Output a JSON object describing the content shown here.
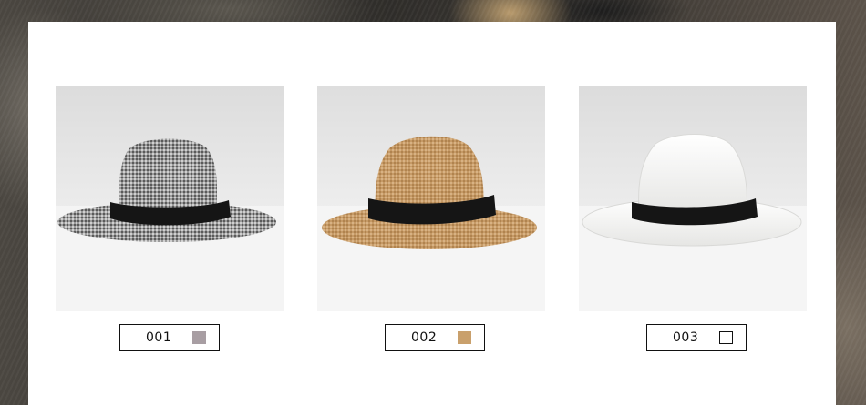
{
  "products": [
    {
      "code": "001",
      "swatch_color": "#a89ea3",
      "swatch_outlined": false,
      "image": "gray-straw-fedora-hat",
      "hat_color": "#8c8c8c"
    },
    {
      "code": "002",
      "swatch_color": "#c9a06c",
      "swatch_outlined": false,
      "image": "tan-straw-fedora-hat",
      "hat_color": "#c69a66"
    },
    {
      "code": "003",
      "swatch_color": "#ffffff",
      "swatch_outlined": true,
      "image": "white-straw-fedora-hat",
      "hat_color": "#f4f4f2"
    }
  ],
  "band_color": "#151515",
  "panel_color": "#ffffff"
}
